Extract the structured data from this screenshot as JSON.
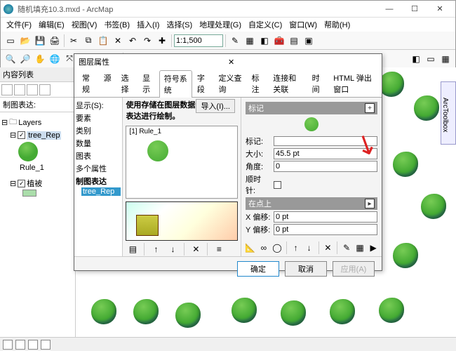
{
  "window": {
    "title": "随机填充10.3.mxd - ArcMap"
  },
  "menu": {
    "file": "文件(F)",
    "edit": "编辑(E)",
    "view": "视图(V)",
    "bookmark": "书签(B)",
    "insert": "插入(I)",
    "select": "选择(S)",
    "geo": "地理处理(G)",
    "custom": "自定义(C)",
    "window": "窗口(W)",
    "help": "帮助(H)"
  },
  "scale": "1:1,500",
  "toc": {
    "title": "内容列表",
    "sub": "制图表达:",
    "layers": "Layers",
    "rule": "Rule_1",
    "rep": "tree_Rep",
    "veg": "植被"
  },
  "toolbox": "ArcToolbox",
  "dialog": {
    "title": "图层属性",
    "tabs": [
      "常规",
      "源",
      "选择",
      "显示",
      "符号系统",
      "字段",
      "定义查询",
      "标注",
      "连接和关联",
      "时间",
      "HTML 弹出窗口"
    ],
    "active": 4,
    "left": {
      "show": "显示(S):",
      "items": [
        "要素",
        "类别",
        "数量",
        "图表",
        "多个属性",
        "制图表达"
      ],
      "sub": "tree_Rep"
    },
    "desc": "使用存储在图层数据源中的制图表达进行绘制。",
    "import": "导入(I)...",
    "mid": {
      "rule": "[1] Rule_1"
    },
    "right": {
      "mark_hdr": "标记",
      "mark_lbl": "标记:",
      "size_lbl": "大小:",
      "size_val": "45.5 pt",
      "angle_lbl": "角度:",
      "angle_val": "0",
      "clock_lbl": "顺时针:",
      "onpt_hdr": "在点上",
      "xoff_lbl": "X 偏移:",
      "xoff_val": "0 pt",
      "yoff_lbl": "Y 偏移:",
      "yoff_val": "0 pt"
    },
    "buttons": {
      "ok": "确定",
      "cancel": "取消",
      "apply": "应用(A)"
    }
  }
}
